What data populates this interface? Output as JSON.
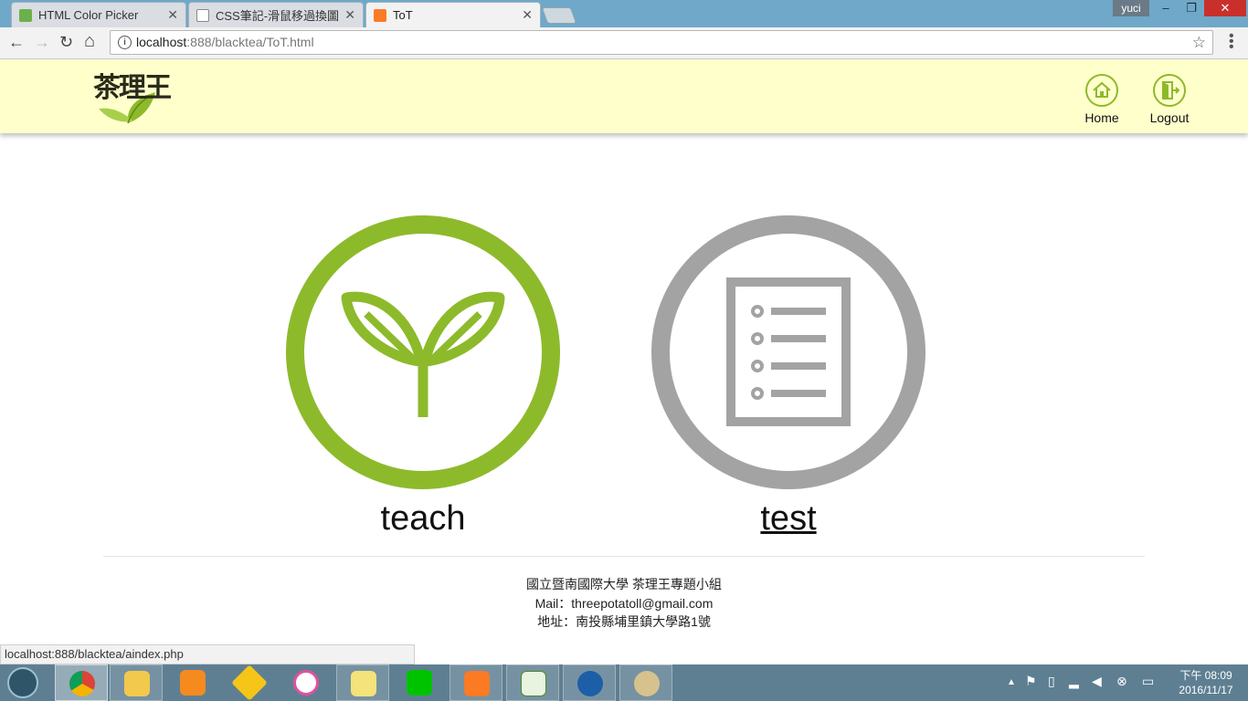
{
  "browser": {
    "tabs": [
      {
        "title": "HTML Color Picker",
        "close": "✕",
        "icon": "color-picker-favicon",
        "color": "#6bb04a"
      },
      {
        "title": "CSS筆記-滑鼠移過換圖 -",
        "close": "✕",
        "icon": "document-favicon",
        "color": "#888888"
      },
      {
        "title": "ToT",
        "close": "✕",
        "icon": "xampp-favicon",
        "color": "#fb7a24",
        "active": true
      }
    ],
    "user": "yuci",
    "window_controls": {
      "minimize": "–",
      "restore": "❐",
      "close": "✕"
    },
    "nav": {
      "back": "←",
      "forward": "→",
      "reload": "↻",
      "home": "⌂"
    },
    "address": {
      "host": "localhost",
      "path": ":888/blacktea/ToT.html",
      "info": "i",
      "star": "☆"
    },
    "menu": "⋮"
  },
  "header": {
    "logo_text": "茶理王",
    "buttons": [
      {
        "label": "Home",
        "icon": "home-icon"
      },
      {
        "label": "Logout",
        "icon": "logout-icon"
      }
    ],
    "accent_color": "#8dba2b",
    "background": "#ffffcc"
  },
  "main": {
    "teach": {
      "caption": "teach",
      "icon": "sprout-icon",
      "color": "#8dba2b"
    },
    "test": {
      "caption": "test",
      "icon": "document-list-icon",
      "color": "#a3a3a3"
    }
  },
  "footer": {
    "line1": "國立暨南國際大學 茶理王專題小組",
    "line2": "Mail：threepotatoll@gmail.com",
    "line3": "地址：南投縣埔里鎮大學路1號"
  },
  "status_url": "localhost:888/blacktea/aindex.php",
  "taskbar": {
    "apps": [
      "chrome-icon",
      "file-explorer-icon",
      "media-player-icon",
      "app-icon",
      "itunes-icon",
      "sticky-notes-icon",
      "line-icon",
      "xampp-icon",
      "notepad-icon",
      "app-icon",
      "paint-icon"
    ],
    "clock_period": "下午 08:09",
    "clock_date": "2016/11/17"
  }
}
